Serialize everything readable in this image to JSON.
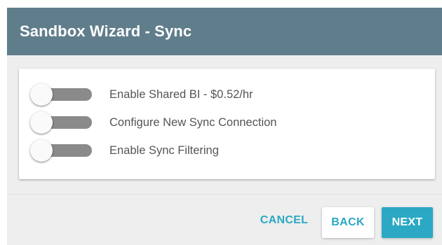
{
  "dialog": {
    "title": "Sandbox Wizard - Sync"
  },
  "options": [
    {
      "label": "Enable Shared BI - $0.52/hr",
      "enabled": false
    },
    {
      "label": "Configure New Sync Connection",
      "enabled": false
    },
    {
      "label": "Enable Sync Filtering",
      "enabled": false
    }
  ],
  "footer": {
    "cancel_label": "CANCEL",
    "back_label": "BACK",
    "next_label": "NEXT"
  },
  "colors": {
    "header": "#607d8b",
    "accent": "#2aa8c4",
    "track_off": "#8a8a8a",
    "panel_bg": "#eeeeee"
  }
}
